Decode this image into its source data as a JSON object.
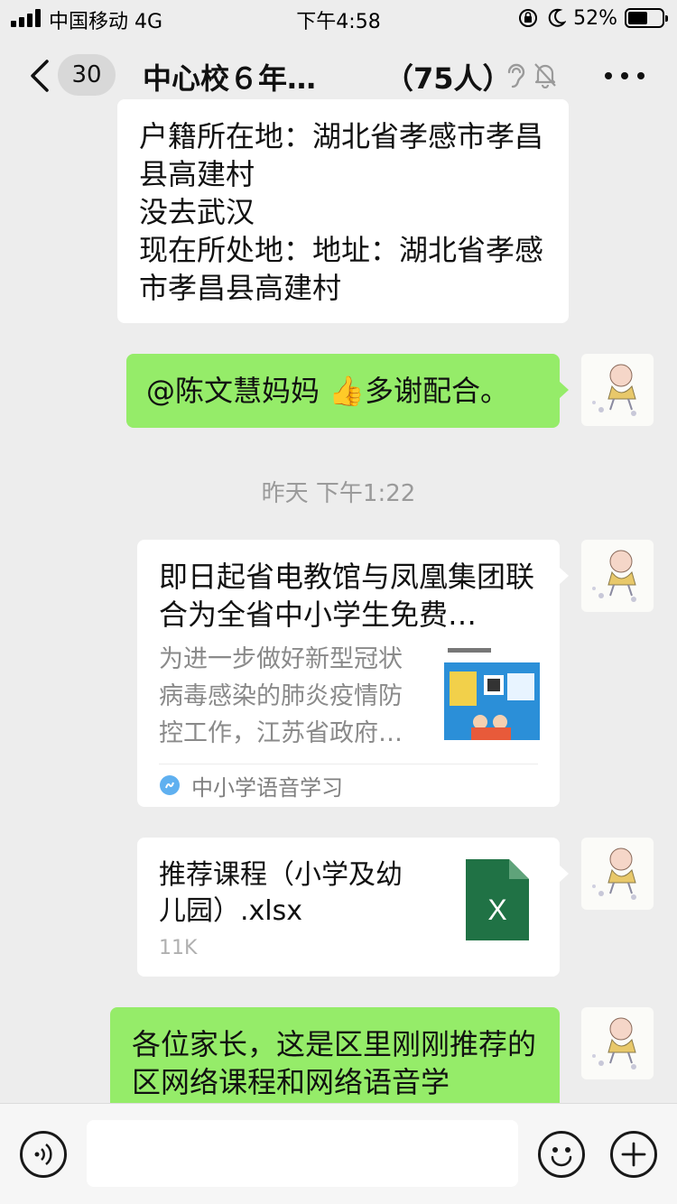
{
  "status_bar": {
    "carrier": "中国移动",
    "network": "4G",
    "time": "下午4:58",
    "battery_percent": "52%",
    "battery_level": 0.52,
    "icons": [
      "signal-icon",
      "rotation-lock-icon",
      "moon-icon",
      "battery-icon"
    ]
  },
  "nav": {
    "unread_count": "30",
    "title": "中心校６年…",
    "member_count": "（75人）",
    "icons": [
      "back-arrow-icon",
      "ear-icon",
      "mute-bell-icon",
      "more-icon"
    ]
  },
  "messages": {
    "info_text": "户籍所在地：湖北省孝感市孝昌县高建村\n没去武汉\n现在所处地：地址：湖北省孝感市孝昌县高建村",
    "reply_mention": "@陈文慧妈妈",
    "reply_emoji": "👍",
    "reply_text": "多谢配合。",
    "timestamp": "昨天 下午1:22",
    "link_card": {
      "title": "即日起省电教馆与凤凰集团联合为全省中小学生免费…",
      "description": "为进一步做好新型冠状病毒感染的肺炎疫情防控工作，江苏省政府…",
      "source": "中小学语音学习"
    },
    "file_card": {
      "name": "推荐课程（小学及幼儿园）.xlsx",
      "size": "11K",
      "icon_letter": "X"
    },
    "partial_text": "各位家长，这是区里刚刚推荐的区网络课程和网络语音学"
  },
  "input_bar": {
    "placeholder": "",
    "icons": [
      "voice-icon",
      "emoji-icon",
      "plus-icon"
    ]
  },
  "colors": {
    "background": "#ededed",
    "sent_bubble": "#95ec69",
    "received_bubble": "#ffffff",
    "excel_green": "#207245",
    "timestamp_gray": "#9a9a9a"
  }
}
